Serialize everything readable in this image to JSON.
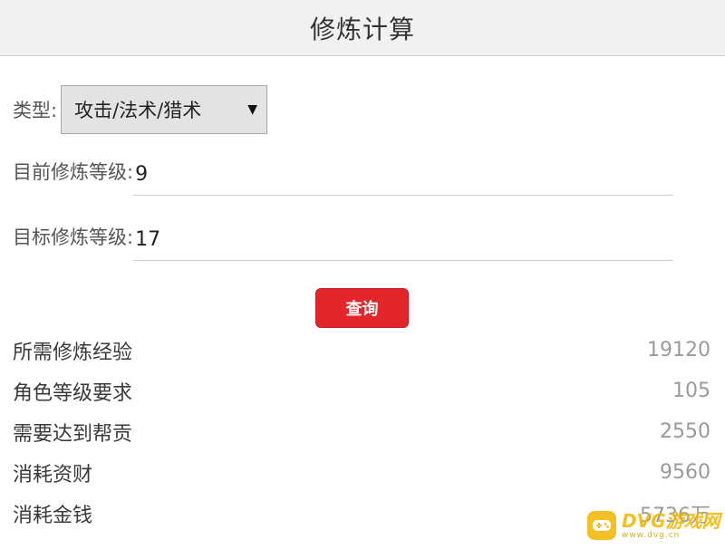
{
  "header": {
    "title": "修炼计算"
  },
  "form": {
    "type_label": "类型:",
    "type_value": "攻击/法术/猎术",
    "current_label": "目前修炼等级:",
    "current_value": "9",
    "target_label": "目标修炼等级:",
    "target_value": "17",
    "query_button": "查询"
  },
  "results": [
    {
      "label": "所需修炼经验",
      "value": "19120"
    },
    {
      "label": "角色等级要求",
      "value": "105"
    },
    {
      "label": "需要达到帮贡",
      "value": "2550"
    },
    {
      "label": "消耗资财",
      "value": "9560"
    },
    {
      "label": "消耗金钱",
      "value": "5736万"
    }
  ],
  "watermark": {
    "main": "DVG游戏网",
    "sub": "www.dvg.cn"
  },
  "colors": {
    "accent": "#e3262b",
    "watermark": "#f0b400"
  },
  "icons": {
    "dropdown": "caret-down-icon",
    "watermark_logo": "gamepad-icon"
  }
}
